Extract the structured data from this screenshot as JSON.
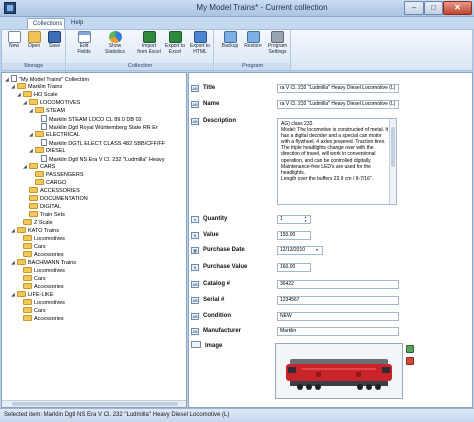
{
  "window": {
    "title": "My Model Trains* - Current collection",
    "controls": {
      "minimize": "–",
      "maximize": "□",
      "close": "✕"
    }
  },
  "menu_tabs": [
    {
      "label": "Collections",
      "active": true
    },
    {
      "label": "Help",
      "active": false
    }
  ],
  "ribbon": {
    "groups": [
      {
        "label": "Storage",
        "buttons": [
          {
            "label": "New",
            "icon": "new-document-icon"
          },
          {
            "label": "Open",
            "icon": "open-folder-icon"
          },
          {
            "label": "Save",
            "icon": "floppy-disk-icon"
          }
        ]
      },
      {
        "label": "Collection",
        "buttons": [
          {
            "label": "Edit Fields",
            "icon": "edit-fields-icon"
          },
          {
            "label": "Show Statistics",
            "icon": "statistics-icon"
          },
          {
            "label": "Import from Excel",
            "icon": "import-excel-icon"
          },
          {
            "label": "Export to Excel",
            "icon": "export-excel-icon"
          },
          {
            "label": "Export to HTML",
            "icon": "export-html-icon"
          }
        ]
      },
      {
        "label": "Program",
        "buttons": [
          {
            "label": "Backup",
            "icon": "backup-icon"
          },
          {
            "label": "Restore",
            "icon": "restore-icon"
          },
          {
            "label": "Program Settings",
            "icon": "tools-icon"
          }
        ]
      }
    ]
  },
  "tree": [
    {
      "label": "\"My Model Trains\" Collection",
      "type": "root"
    },
    {
      "label": "Marklin Trains",
      "type": "folder",
      "expanded": true
    },
    {
      "label": "HO Scale",
      "type": "folder",
      "expanded": true
    },
    {
      "label": "LOCOMOTIVES",
      "type": "folder",
      "expanded": true
    },
    {
      "label": "STEAM",
      "type": "folder",
      "expanded": true
    },
    {
      "label": "Marklin STEAM LOCO CL 89.0 DB 02",
      "type": "item"
    },
    {
      "label": "Marklin Dgtl Royal Württemberg State RR Er",
      "type": "item"
    },
    {
      "label": "ELECTRICAL",
      "type": "folder",
      "expanded": true
    },
    {
      "label": "Marklin DGTL ELECT CLASS 482 SBB/CFF/FF",
      "type": "item"
    },
    {
      "label": "DIESEL",
      "type": "folder",
      "expanded": true
    },
    {
      "label": "Marklin Dgtl NS Era V Cl. 232 \"Ludmilla\" Heavy",
      "type": "item"
    },
    {
      "label": "CARS",
      "type": "folder",
      "expanded": true
    },
    {
      "label": "PASSENGERS",
      "type": "folder"
    },
    {
      "label": "CARGO",
      "type": "folder"
    },
    {
      "label": "ACCESSORIES",
      "type": "folder"
    },
    {
      "label": "DOCUMENTATION",
      "type": "folder"
    },
    {
      "label": "DIGITAL",
      "type": "folder"
    },
    {
      "label": "Train Sets",
      "type": "folder"
    },
    {
      "label": "Z Scale",
      "type": "folder"
    },
    {
      "label": "KATO Trains",
      "type": "folder",
      "expanded": true
    },
    {
      "label": "Locomotives",
      "type": "folder"
    },
    {
      "label": "Cars",
      "type": "folder"
    },
    {
      "label": "Accessories",
      "type": "folder"
    },
    {
      "label": "BACHMANN Trains",
      "type": "folder",
      "expanded": true
    },
    {
      "label": "Locomotives",
      "type": "folder"
    },
    {
      "label": "Cars",
      "type": "folder"
    },
    {
      "label": "Accessories",
      "type": "folder"
    },
    {
      "label": "LIFE-LIKE",
      "type": "folder",
      "expanded": true
    },
    {
      "label": "Locomotives",
      "type": "folder"
    },
    {
      "label": "Cars",
      "type": "folder"
    },
    {
      "label": "Accessories",
      "type": "folder"
    }
  ],
  "fields": {
    "title": {
      "label": "Title",
      "value": "ra V Cl. 232 \"Ludmilla\" Heavy Diesel Locomotive (L)"
    },
    "name": {
      "label": "Name",
      "value": "ra V Cl. 232 \"Ludmilla\" Heavy Diesel Locomotive (L)"
    },
    "description": {
      "label": "Description",
      "value": "AG) class 232.\nModel: The locomotive is constructed of metal. It has a digital decoder and a special can motor with a flywheel. 4 axles powered. Traction tires. The triple headlights change over with the direction of travel, will work in conventional operation, and can be controlled digitally. Maintenance-free LED's are used for the headlights.\nLength over the buffers 23.9 cm / 9-7/16\"."
    },
    "quantity": {
      "label": "Quantity",
      "value": "1"
    },
    "value": {
      "label": "Value",
      "value": "150.00"
    },
    "purchase_date": {
      "label": "Purchase Date",
      "value": "12/13/2010"
    },
    "purchase_value": {
      "label": "Purchase Value",
      "value": "160.00"
    },
    "catalog": {
      "label": "Catalog #",
      "value": "36422"
    },
    "serial": {
      "label": "Serial #",
      "value": "1234567"
    },
    "condition": {
      "label": "Condition",
      "value": "NEW"
    },
    "manufacturer": {
      "label": "Manufacturer",
      "value": "Marklin"
    },
    "image": {
      "label": "Image"
    }
  },
  "status": {
    "text": "Selected item: Marklin Dgtl NS Era V Cl. 232 \"Ludmilla\" Heavy Diesel Locomotive (L)"
  },
  "colors": {
    "locomotive_body": "#c8242a",
    "locomotive_roof": "#6b6f75",
    "ribbon_bg": "#dae6f4",
    "window_frame": "#b9d1ea"
  }
}
